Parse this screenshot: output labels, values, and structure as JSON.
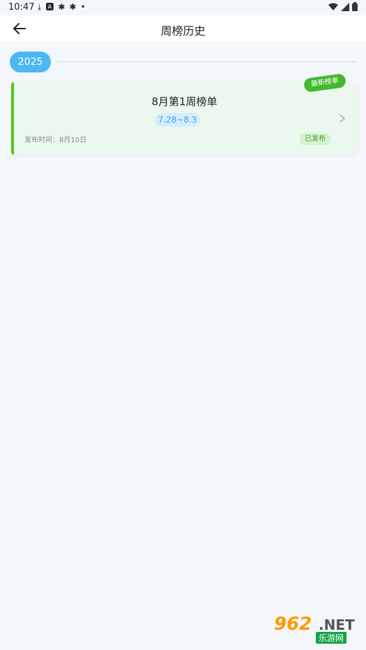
{
  "status_bar": {
    "time": "10:47",
    "icons": [
      "download-icon",
      "a-icon",
      "bug-icon",
      "bug-icon",
      "dot-icon"
    ],
    "right_icons": [
      "wifi-icon",
      "signal-icon",
      "battery-icon"
    ]
  },
  "app_bar": {
    "title": "周榜历史",
    "back_icon": "arrow-left-icon"
  },
  "timeline": {
    "year": "2025"
  },
  "card": {
    "title": "8月第1周榜单",
    "date_range": "7.28~8.3",
    "publish_time": "发布时间：8月10日",
    "status": "已发布",
    "new_tag": "最新榜单",
    "chevron_icon": "chevron-right-icon"
  },
  "watermark": {
    "number": "962",
    "domain": ".NET",
    "site_name": "乐游网"
  },
  "colors": {
    "background": "#f3f6fa",
    "accent_blue": "#4db8f2",
    "accent_green": "#52c41a",
    "card_bg": "#eaf8ee"
  }
}
